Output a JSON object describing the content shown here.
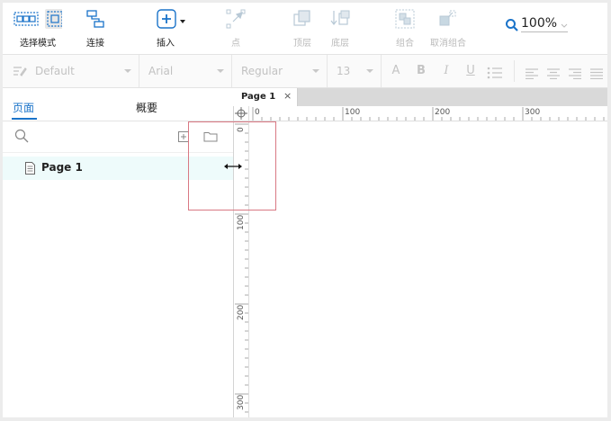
{
  "toolbar": {
    "select_mode": {
      "label": "选择模式",
      "icon": "select-mode-icon"
    },
    "connect": {
      "label": "连接",
      "icon": "connect-icon"
    },
    "insert": {
      "label": "插入",
      "icon": "insert-plus-icon"
    },
    "point": {
      "label": "点",
      "icon": "point-icon"
    },
    "bring_front": {
      "label": "顶层",
      "icon": "bring-to-front-icon"
    },
    "send_back": {
      "label": "底层",
      "icon": "send-to-back-icon"
    },
    "group": {
      "label": "组合",
      "icon": "group-icon"
    },
    "ungroup": {
      "label": "取消组合",
      "icon": "ungroup-icon"
    },
    "zoom": {
      "value": "100%",
      "icon": "zoom-search-icon"
    }
  },
  "format_bar": {
    "style": "Default",
    "font": "Arial",
    "weight": "Regular",
    "size": "13",
    "buttons": [
      "A",
      "B",
      "I",
      "U"
    ]
  },
  "left_panel": {
    "tabs": [
      "页面",
      "概要"
    ],
    "active_tab": "页面",
    "pages": [
      {
        "label": "Page 1"
      }
    ]
  },
  "canvas": {
    "tab": {
      "label": "Page 1",
      "close": "×"
    },
    "hruler_labels": [
      "0",
      "100",
      "200",
      "300"
    ],
    "vruler_labels": [
      "0",
      "100",
      "200",
      "300"
    ]
  },
  "colors": {
    "accent": "#1a73c9",
    "highlight": "#d97883",
    "selected_row": "#eefbfb"
  }
}
